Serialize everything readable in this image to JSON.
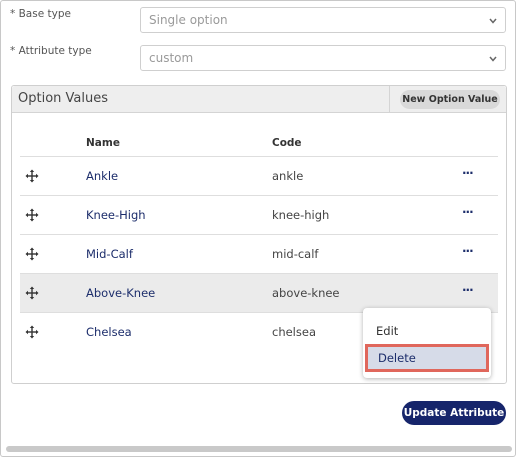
{
  "form": {
    "base_type": {
      "label": "* Base type",
      "value": "Single option"
    },
    "attribute_type": {
      "label": "* Attribute type",
      "value": "custom"
    }
  },
  "option_values": {
    "title": "Option Values",
    "new_button": "New Option Value",
    "columns": {
      "name": "Name",
      "code": "Code"
    },
    "rows": [
      {
        "name": "Ankle",
        "code": "ankle",
        "more": "···"
      },
      {
        "name": "Knee-High",
        "code": "knee-high",
        "more": "···"
      },
      {
        "name": "Mid-Calf",
        "code": "mid-calf",
        "more": "···"
      },
      {
        "name": "Above-Knee",
        "code": "above-knee",
        "more": "···"
      },
      {
        "name": "Chelsea",
        "code": "chelsea",
        "more": ""
      }
    ]
  },
  "context_menu": {
    "edit": "Edit",
    "delete": "Delete"
  },
  "footer": {
    "update_button": "Update Attribute"
  },
  "colors": {
    "accent": "#16256b",
    "link": "#1c2d6b",
    "highlight_border": "#e0675c",
    "row_highlight": "#ebebeb"
  },
  "icons": {
    "drag": "drag-handle-icon",
    "chevron": "chevron-down-icon",
    "more": "more-horizontal-icon"
  }
}
